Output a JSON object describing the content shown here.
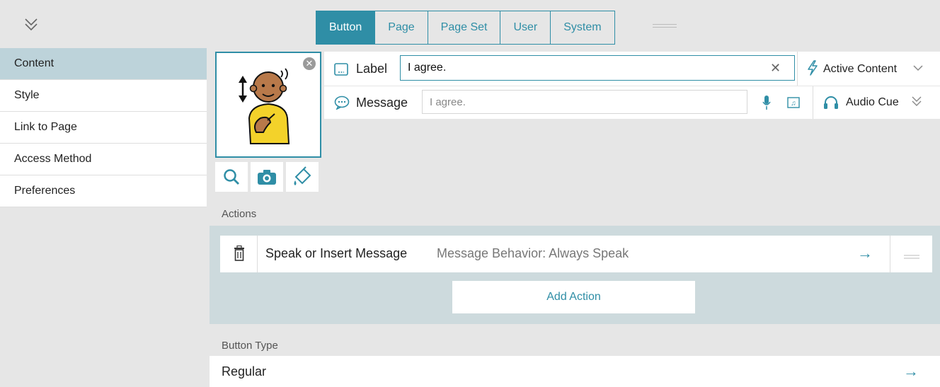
{
  "toolbar": {
    "collapse_icon": "double-chevron-down-icon",
    "tabs": [
      {
        "label": "Button",
        "active": true
      },
      {
        "label": "Page",
        "active": false
      },
      {
        "label": "Page Set",
        "active": false
      },
      {
        "label": "User",
        "active": false
      },
      {
        "label": "System",
        "active": false
      }
    ]
  },
  "sidebar": {
    "items": [
      {
        "label": "Content",
        "active": true
      },
      {
        "label": "Style",
        "active": false
      },
      {
        "label": "Link to Page",
        "active": false
      },
      {
        "label": "Access Method",
        "active": false
      },
      {
        "label": "Preferences",
        "active": false
      }
    ]
  },
  "content": {
    "label_title": "Label",
    "label_value": "I agree.",
    "message_title": "Message",
    "message_value": "I agree.",
    "active_content": "Active Content",
    "audio_cue": "Audio Cue",
    "image_tools": [
      "search-icon",
      "camera-icon",
      "paint-bucket-icon"
    ]
  },
  "actions": {
    "section_label": "Actions",
    "items": [
      {
        "name": "Speak or Insert Message",
        "detail": "Message Behavior: Always Speak"
      }
    ],
    "add_label": "Add Action"
  },
  "button_type": {
    "section_label": "Button Type",
    "value": "Regular"
  },
  "colors": {
    "accent": "#2f8ea6",
    "active_nav": "#bdd3da",
    "actions_panel": "#cddadd"
  }
}
